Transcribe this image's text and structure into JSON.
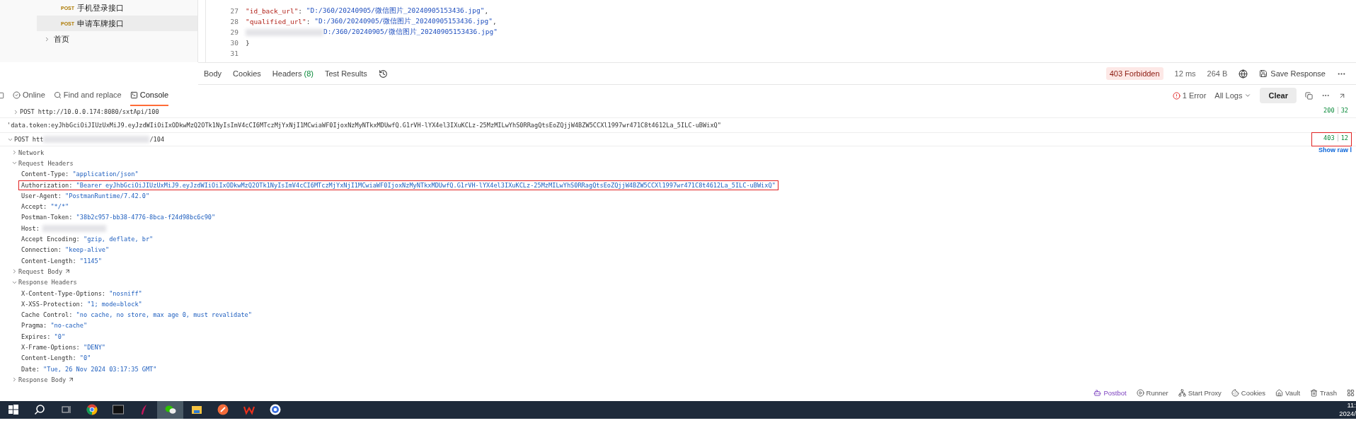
{
  "sidebar": {
    "items": [
      {
        "method": "POST",
        "label": "手机登录接口",
        "selected": false
      },
      {
        "method": "POST",
        "label": "申请车牌接口",
        "selected": true
      }
    ],
    "folders": [
      {
        "label": "首页",
        "expanded": false
      }
    ]
  },
  "editor": {
    "lines": [
      {
        "number": "27",
        "tokens": [
          {
            "kind": "key",
            "text": "\"id_back_url\""
          },
          {
            "kind": "punct",
            "text": ": "
          },
          {
            "kind": "string",
            "text": "\"D:/360/20240905/微信图片_20240905153436.jpg\""
          },
          {
            "kind": "punct",
            "text": ","
          }
        ]
      },
      {
        "number": "28",
        "tokens": [
          {
            "kind": "key",
            "text": "\"qualified_url\""
          },
          {
            "kind": "punct",
            "text": ": "
          },
          {
            "kind": "string",
            "text": "\"D:/360/20240905/微信图片_20240905153436.jpg\""
          },
          {
            "kind": "punct",
            "text": ","
          }
        ]
      },
      {
        "number": "29",
        "tokens": [
          {
            "kind": "blur"
          },
          {
            "kind": "string",
            "text": "D:/360/20240905/微信图片_20240905153436.jpg\""
          }
        ]
      },
      {
        "number": "30",
        "tokens": [
          {
            "kind": "punct",
            "text": "}"
          }
        ]
      },
      {
        "number": "31"
      }
    ]
  },
  "response_tabs": [
    {
      "label": "Body"
    },
    {
      "label": "Cookies"
    },
    {
      "label": "Headers",
      "count": "(8)"
    },
    {
      "label": "Test Results"
    }
  ],
  "response_status": {
    "status": "403 Forbidden",
    "time": "12 ms",
    "size": "264 B",
    "save": "Save Response"
  },
  "console_tabs": [
    {
      "label": "Online",
      "kind": "online",
      "selected": false
    },
    {
      "label": "Find and replace",
      "kind": "find",
      "selected": false
    },
    {
      "label": "Console",
      "kind": "console",
      "selected": true
    }
  ],
  "console_controls": {
    "errors": "1 Error",
    "filter": "All Logs",
    "clear": "Clear"
  },
  "logs": [
    {
      "kind": "request",
      "method": "POST",
      "url": "http://10.0.0.174:8080/sxtApi/100",
      "status": "200",
      "time": "32",
      "highlighted": false,
      "expanded": false
    },
    {
      "kind": "message",
      "text": "'data.token:eyJhbGciOiJIUzUxMiJ9.eyJzdWIiOiIxODkwMzQ2OTk1NyIsImV4cCI6MTczMjYxNjI1MCwiaWF0IjoxNzMyNTkxMDUwfQ.G1rVH-lYX4el3IXuKCLz-25MzMILwYhS0RRagQtsEoZQjjW4BZW5CCXl1997wr471C8t4612La_5ILC-uBWixQ\""
    },
    {
      "kind": "request",
      "method": "POST",
      "url": "htt",
      "url_blurred": true,
      "url_end": "/104",
      "status": "403",
      "time": "12",
      "highlighted": true,
      "expanded": true,
      "link": "Show raw l",
      "sections": [
        {
          "label": "Network",
          "expanded": false
        },
        {
          "label": "Request Headers",
          "expanded": true,
          "headers": [
            {
              "name": "Content-Type:",
              "value": "\"application/json\"",
              "highlighted": false
            },
            {
              "name": "Authorization:",
              "value": "\"Bearer eyJhbGciOiJIUzUxMiJ9.eyJzdWIiOiIxODkwMzQ2OTk1NyIsImV4cCI6MTczMjYxNjI1MCwiaWF0IjoxNzMyNTkxMDUwfQ.G1rVH-lYX4el3IXuKCLz-25MzMILwYhS0RRagQtsEoZQjjW4BZW5CCXl1997wr471C8t4612La_5ILC-uBWixQ\"",
              "highlighted": true
            },
            {
              "name": "User-Agent:",
              "value": "\"PostmanRuntime/7.42.0\"",
              "highlighted": false
            },
            {
              "name": "Accept:",
              "value": "\"*/*\"",
              "highlighted": false
            },
            {
              "name": "Postman-Token:",
              "value": "\"38b2c957-bb38-4776-8bca-f24d98bc6c90\"",
              "highlighted": false
            },
            {
              "name": "Host:",
              "blurred": true,
              "highlighted": false
            },
            {
              "name": "Accept Encoding:",
              "value": "\"gzip, deflate, br\"",
              "highlighted": false
            },
            {
              "name": "Connection:",
              "value": "\"keep-alive\"",
              "highlighted": false
            },
            {
              "name": "Content-Length:",
              "value": "\"1145\"",
              "highlighted": false
            }
          ]
        },
        {
          "label": "Request Body",
          "expanded": false,
          "external": true
        },
        {
          "label": "Response Headers",
          "expanded": true,
          "headers": [
            {
              "name": "X-Content-Type-Options:",
              "value": "\"nosniff\"",
              "highlighted": false
            },
            {
              "name": "X-XSS-Protection:",
              "value": "\"1; mode=block\"",
              "highlighted": false
            },
            {
              "name": "Cache Control:",
              "value": "\"no cache, no store, max age 0, must revalidate\"",
              "highlighted": false
            },
            {
              "name": "Pragma:",
              "value": "\"no-cache\"",
              "highlighted": false
            },
            {
              "name": "Expires:",
              "value": "\"0\"",
              "highlighted": false
            },
            {
              "name": "X-Frame-Options:",
              "value": "\"DENY\"",
              "highlighted": false
            },
            {
              "name": "Content-Length:",
              "value": "\"0\"",
              "highlighted": false
            },
            {
              "name": "Date:",
              "value": "\"Tue, 26 Nov 2024 03:17:35 GMT\"",
              "highlighted": false
            }
          ]
        },
        {
          "label": "Response Body",
          "expanded": false,
          "external": true
        }
      ]
    }
  ],
  "status_bar": [
    {
      "label": "Postbot",
      "kind": "postbot"
    },
    {
      "label": "Runner",
      "kind": "runner"
    },
    {
      "label": "Start Proxy",
      "kind": "proxy"
    },
    {
      "label": "Cookies",
      "kind": "cookies"
    },
    {
      "label": "Vault",
      "kind": "vault"
    },
    {
      "label": "Trash",
      "kind": "trash"
    }
  ],
  "taskbar": {
    "apps": [
      {
        "kind": "start",
        "active": false
      },
      {
        "kind": "search",
        "active": false
      },
      {
        "kind": "taskview",
        "active": false
      },
      {
        "kind": "chrome",
        "active": false
      },
      {
        "kind": "terminal",
        "active": false
      },
      {
        "kind": "feather",
        "active": false
      },
      {
        "kind": "wechat",
        "active": true
      },
      {
        "kind": "folder",
        "active": false
      },
      {
        "kind": "pen",
        "active": false
      },
      {
        "kind": "wps",
        "active": false
      },
      {
        "kind": "ring",
        "active": false
      }
    ],
    "time": "11:",
    "date": "2024/"
  }
}
